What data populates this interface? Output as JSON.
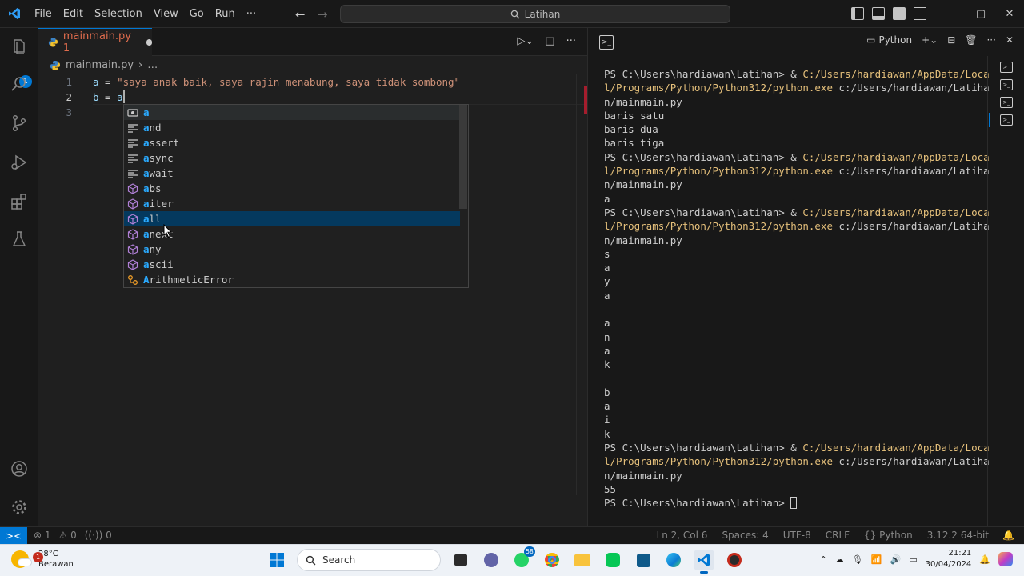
{
  "window": {
    "menu": [
      "File",
      "Edit",
      "Selection",
      "View",
      "Go",
      "Run",
      "···"
    ],
    "search_text": "Latihan",
    "controls": [
      "—",
      "▢",
      "✕"
    ]
  },
  "activity": {
    "explorer_badge": "1",
    "icons": [
      "files-icon",
      "search-icon",
      "source-control-icon",
      "run-debug-icon",
      "extensions-icon",
      "testing-icon",
      "account-icon",
      "settings-gear-icon"
    ]
  },
  "editor": {
    "tab_label": "mainmain.py 1",
    "breadcrumb_file": "mainmain.py",
    "breadcrumb_rest": "…",
    "line_numbers": [
      "1",
      "2",
      "3"
    ],
    "lines": [
      {
        "var": "a",
        "op": " = ",
        "str": "\"saya anak baik, saya rajin menabung, saya tidak sombong\""
      },
      {
        "var": "b",
        "op": " = ",
        "str": "",
        "typed": "a"
      }
    ]
  },
  "suggest": {
    "items": [
      {
        "label": "a",
        "kind": "variable"
      },
      {
        "label": "and",
        "kind": "keyword"
      },
      {
        "label": "assert",
        "kind": "keyword"
      },
      {
        "label": "async",
        "kind": "keyword"
      },
      {
        "label": "await",
        "kind": "keyword"
      },
      {
        "label": "abs",
        "kind": "function"
      },
      {
        "label": "aiter",
        "kind": "function"
      },
      {
        "label": "all",
        "kind": "function"
      },
      {
        "label": "anext",
        "kind": "function"
      },
      {
        "label": "any",
        "kind": "function"
      },
      {
        "label": "ascii",
        "kind": "function"
      },
      {
        "label": "ArithmeticError",
        "kind": "class"
      }
    ]
  },
  "terminal": {
    "shell_label": "Python",
    "lines": [
      {
        "prompt": "PS C:\\Users\\hardiawan\\Latihan> & ",
        "path": "C:/Users/hardiawan/AppData/Loca",
        "rest": ""
      },
      {
        "prompt": "",
        "path": "l/Programs/Python/Python312/python.exe",
        "rest": " c:/Users/hardiawan/Latiha"
      },
      {
        "prompt": "n/mainmain.py",
        "path": "",
        "rest": ""
      },
      {
        "prompt": "baris satu",
        "path": "",
        "rest": ""
      },
      {
        "prompt": "baris dua",
        "path": "",
        "rest": ""
      },
      {
        "prompt": "baris tiga",
        "path": "",
        "rest": ""
      },
      {
        "prompt": "PS C:\\Users\\hardiawan\\Latihan> & ",
        "path": "C:/Users/hardiawan/AppData/Loca",
        "rest": ""
      },
      {
        "prompt": "",
        "path": "l/Programs/Python/Python312/python.exe",
        "rest": " c:/Users/hardiawan/Latiha"
      },
      {
        "prompt": "n/mainmain.py",
        "path": "",
        "rest": ""
      },
      {
        "prompt": "a",
        "path": "",
        "rest": ""
      },
      {
        "prompt": "PS C:\\Users\\hardiawan\\Latihan> & ",
        "path": "C:/Users/hardiawan/AppData/Loca",
        "rest": ""
      },
      {
        "prompt": "",
        "path": "l/Programs/Python/Python312/python.exe",
        "rest": " c:/Users/hardiawan/Latiha"
      },
      {
        "prompt": "n/mainmain.py",
        "path": "",
        "rest": ""
      },
      {
        "prompt": "s",
        "path": "",
        "rest": ""
      },
      {
        "prompt": "a",
        "path": "",
        "rest": ""
      },
      {
        "prompt": "y",
        "path": "",
        "rest": ""
      },
      {
        "prompt": "a",
        "path": "",
        "rest": ""
      },
      {
        "prompt": "",
        "path": "",
        "rest": ""
      },
      {
        "prompt": "a",
        "path": "",
        "rest": ""
      },
      {
        "prompt": "n",
        "path": "",
        "rest": ""
      },
      {
        "prompt": "a",
        "path": "",
        "rest": ""
      },
      {
        "prompt": "k",
        "path": "",
        "rest": ""
      },
      {
        "prompt": "",
        "path": "",
        "rest": ""
      },
      {
        "prompt": "b",
        "path": "",
        "rest": ""
      },
      {
        "prompt": "a",
        "path": "",
        "rest": ""
      },
      {
        "prompt": "i",
        "path": "",
        "rest": ""
      },
      {
        "prompt": "k",
        "path": "",
        "rest": ""
      },
      {
        "prompt": "PS C:\\Users\\hardiawan\\Latihan> & ",
        "path": "C:/Users/hardiawan/AppData/Loca",
        "rest": ""
      },
      {
        "prompt": "",
        "path": "l/Programs/Python/Python312/python.exe",
        "rest": " c:/Users/hardiawan/Latiha"
      },
      {
        "prompt": "n/mainmain.py",
        "path": "",
        "rest": ""
      },
      {
        "prompt": "55",
        "path": "",
        "rest": ""
      },
      {
        "prompt": "PS C:\\Users\\hardiawan\\Latihan> ",
        "path": "",
        "rest": "",
        "cursor": true
      }
    ]
  },
  "status": {
    "remote": "><",
    "errors": "1",
    "warnings": "0",
    "ports": "0",
    "position": "Ln 2, Col 6",
    "spaces": "Spaces: 4",
    "encoding": "UTF-8",
    "eol": "CRLF",
    "language": "Python",
    "interpreter": "3.12.2 64-bit"
  },
  "taskbar": {
    "weather_temp": "28°C",
    "weather_desc": "Berawan",
    "weather_badge": "1",
    "search_label": "Search",
    "whatsapp_badge": "58",
    "time": "21:21",
    "date": "30/04/2024"
  },
  "colors": {
    "accent": "#0078d4",
    "tab_modified": "#e06c4d",
    "terminal_path": "#e5c07b",
    "suggest_focus": "#04395e"
  }
}
